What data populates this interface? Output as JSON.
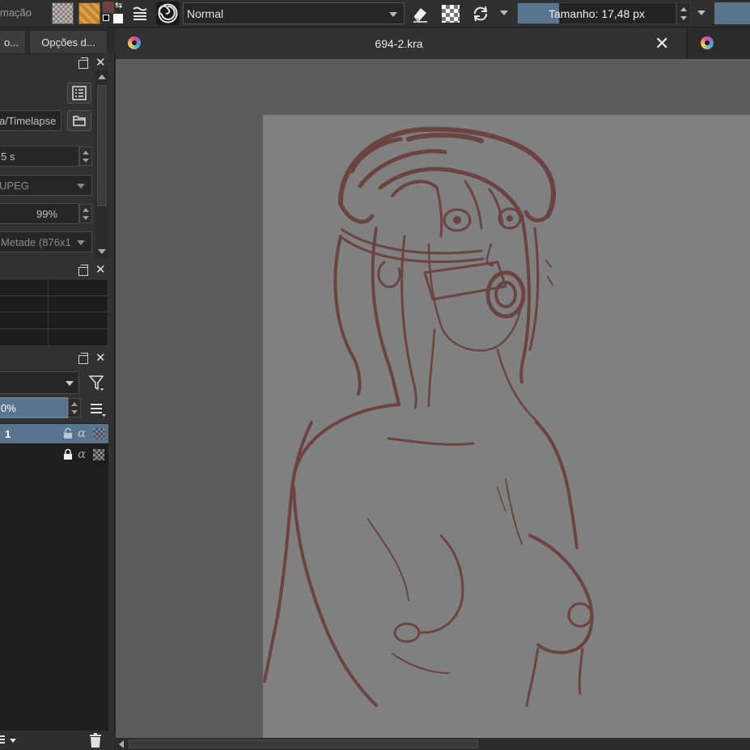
{
  "toolbar": {
    "cut_label": "mação",
    "blend_mode": "Normal",
    "brush_size_label": "Tamanho: 17,48 px",
    "brush_size_fill": 0.26,
    "icons": [
      "pattern-swatch",
      "gradient-swatch",
      "color-pair",
      "flow-icon",
      "wrap-icon",
      "eraser-icon",
      "alpha-lock-icon",
      "reload-icon"
    ]
  },
  "colors": {
    "foreground": "#6b4442",
    "background": "#ffffff",
    "accent": "#5a7490",
    "sketch_stroke": "#6b4442"
  },
  "left_dock": {
    "tabs": [
      {
        "label": "o..."
      },
      {
        "label": "Opções d..."
      }
    ],
    "recorder": {
      "directory": "a/Timelapse",
      "interval": "5 s",
      "format": "UPEG",
      "quality": "99%",
      "resolution": "Metade (876x1"
    },
    "layers": {
      "opacity": "0%",
      "items": [
        {
          "name": "1",
          "selected": true
        },
        {
          "name": "",
          "selected": false
        }
      ]
    }
  },
  "document": {
    "title": "694-2.kra"
  }
}
